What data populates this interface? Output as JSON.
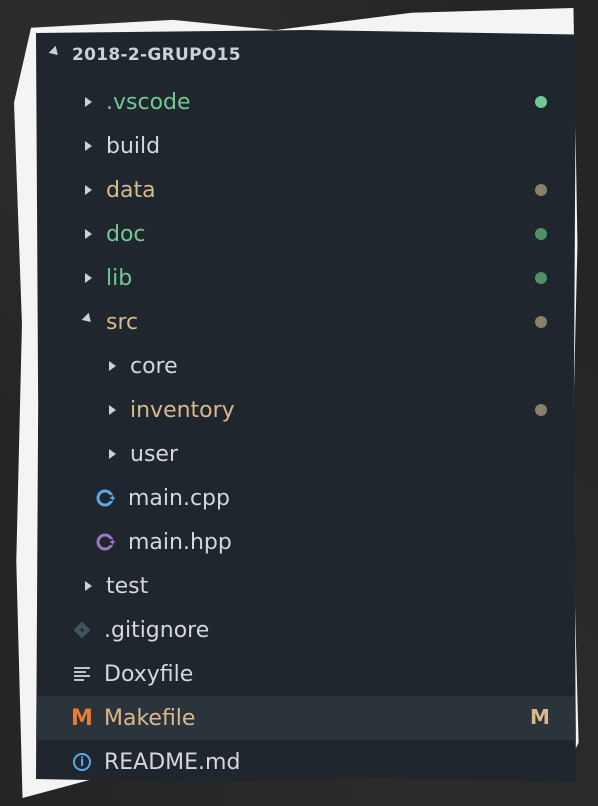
{
  "explorer": {
    "root_label": "2018-2-GRUPO15",
    "rows": [
      {
        "label": ".vscode",
        "dot": "#73c991"
      },
      {
        "label": "build"
      },
      {
        "label": "data",
        "dot": "#8a7f6a"
      },
      {
        "label": "doc",
        "dot": "#4f8f6a"
      },
      {
        "label": "lib",
        "dot": "#4f8f6a"
      },
      {
        "label": "src",
        "dot": "#8a7f6a"
      },
      {
        "label": "core"
      },
      {
        "label": "inventory",
        "dot": "#8a7f6a"
      },
      {
        "label": "user"
      },
      {
        "label": "main.cpp",
        "icon": "cpp-file-icon"
      },
      {
        "label": "main.hpp",
        "icon": "hpp-file-icon"
      },
      {
        "label": "test"
      },
      {
        "label": ".gitignore",
        "icon": "git-icon"
      },
      {
        "label": "Doxyfile",
        "icon": "lines-file-icon"
      },
      {
        "label": "Makefile",
        "icon": "makefile-icon",
        "icon_glyph": "M",
        "status": "M"
      },
      {
        "label": "README.md",
        "icon": "info-icon",
        "icon_glyph": "i"
      }
    ]
  },
  "colors": {
    "modified_green": "#73c991",
    "untracked_tan": "#d9b88f",
    "panel_bg": "#1f262d",
    "selection_bg": "#2b333b"
  }
}
